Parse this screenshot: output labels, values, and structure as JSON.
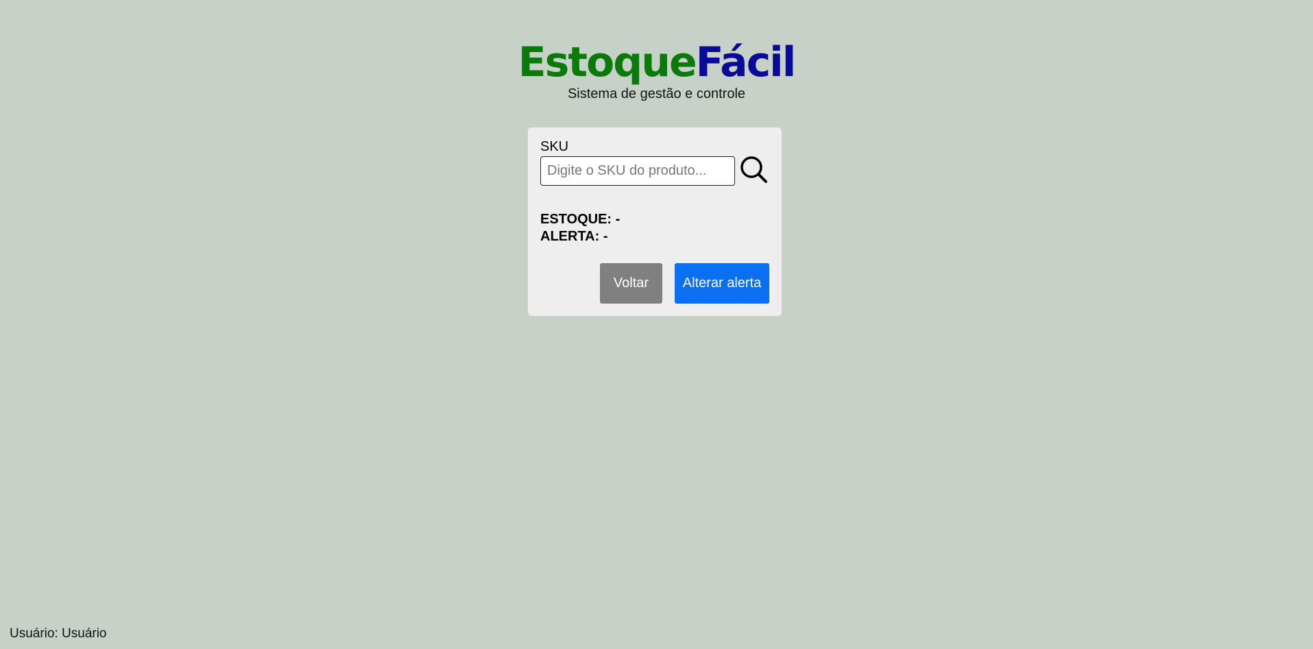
{
  "brand": {
    "part1": "Estoque",
    "part2": "Fácil",
    "color1": "#0a7a0a",
    "color2": "#0a0a9a"
  },
  "subtitle": "Sistema de gestão e controle",
  "form": {
    "sku_label": "SKU",
    "sku_value": "",
    "sku_placeholder": "Digite o SKU do produto...",
    "search_icon": "search-icon"
  },
  "info": {
    "stock": "ESTOQUE: -",
    "alert": "ALERTA: -"
  },
  "buttons": {
    "back": "Voltar",
    "change_alert": "Alterar alerta",
    "back_color": "#808080",
    "change_alert_color": "#0a6ff0"
  },
  "footer": {
    "user": "Usuário: Usuário"
  }
}
